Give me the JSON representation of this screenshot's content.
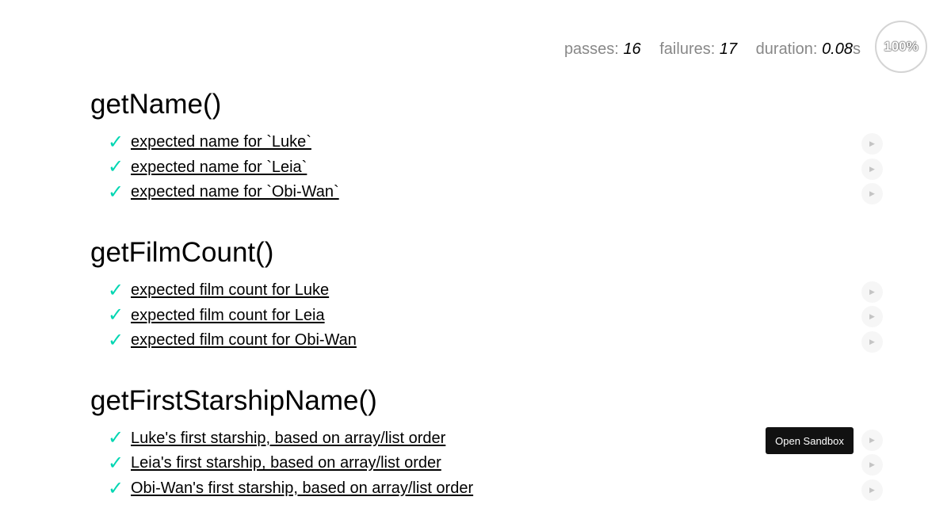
{
  "stats": {
    "passes_label": "passes:",
    "passes": "16",
    "failures_label": "failures:",
    "failures": "17",
    "duration_label": "duration:",
    "duration": "0.08",
    "duration_unit": "s",
    "progress_percent": "100%"
  },
  "suites": [
    {
      "title": "getName()",
      "tests": [
        {
          "title": "expected name for `Luke`",
          "status": "pass"
        },
        {
          "title": "expected name for `Leia`",
          "status": "pass"
        },
        {
          "title": "expected name for `Obi-Wan`",
          "status": "pass"
        }
      ]
    },
    {
      "title": "getFilmCount()",
      "tests": [
        {
          "title": "expected film count for Luke",
          "status": "pass"
        },
        {
          "title": "expected film count for Leia",
          "status": "pass"
        },
        {
          "title": "expected film count for Obi-Wan",
          "status": "pass"
        }
      ]
    },
    {
      "title": "getFirstStarshipName()",
      "tests": [
        {
          "title": "Luke's first starship, based on array/list order",
          "status": "pass"
        },
        {
          "title": "Leia's first starship, based on array/list order",
          "status": "pass"
        },
        {
          "title": "Obi-Wan's first starship, based on array/list order",
          "status": "pass"
        }
      ]
    }
  ],
  "icons": {
    "check": "✓",
    "replay": "▶"
  },
  "tooltip": {
    "text": "Open Sandbox"
  },
  "colors": {
    "pass_check": "#00d6b2",
    "tooltip_bg": "#111111"
  }
}
